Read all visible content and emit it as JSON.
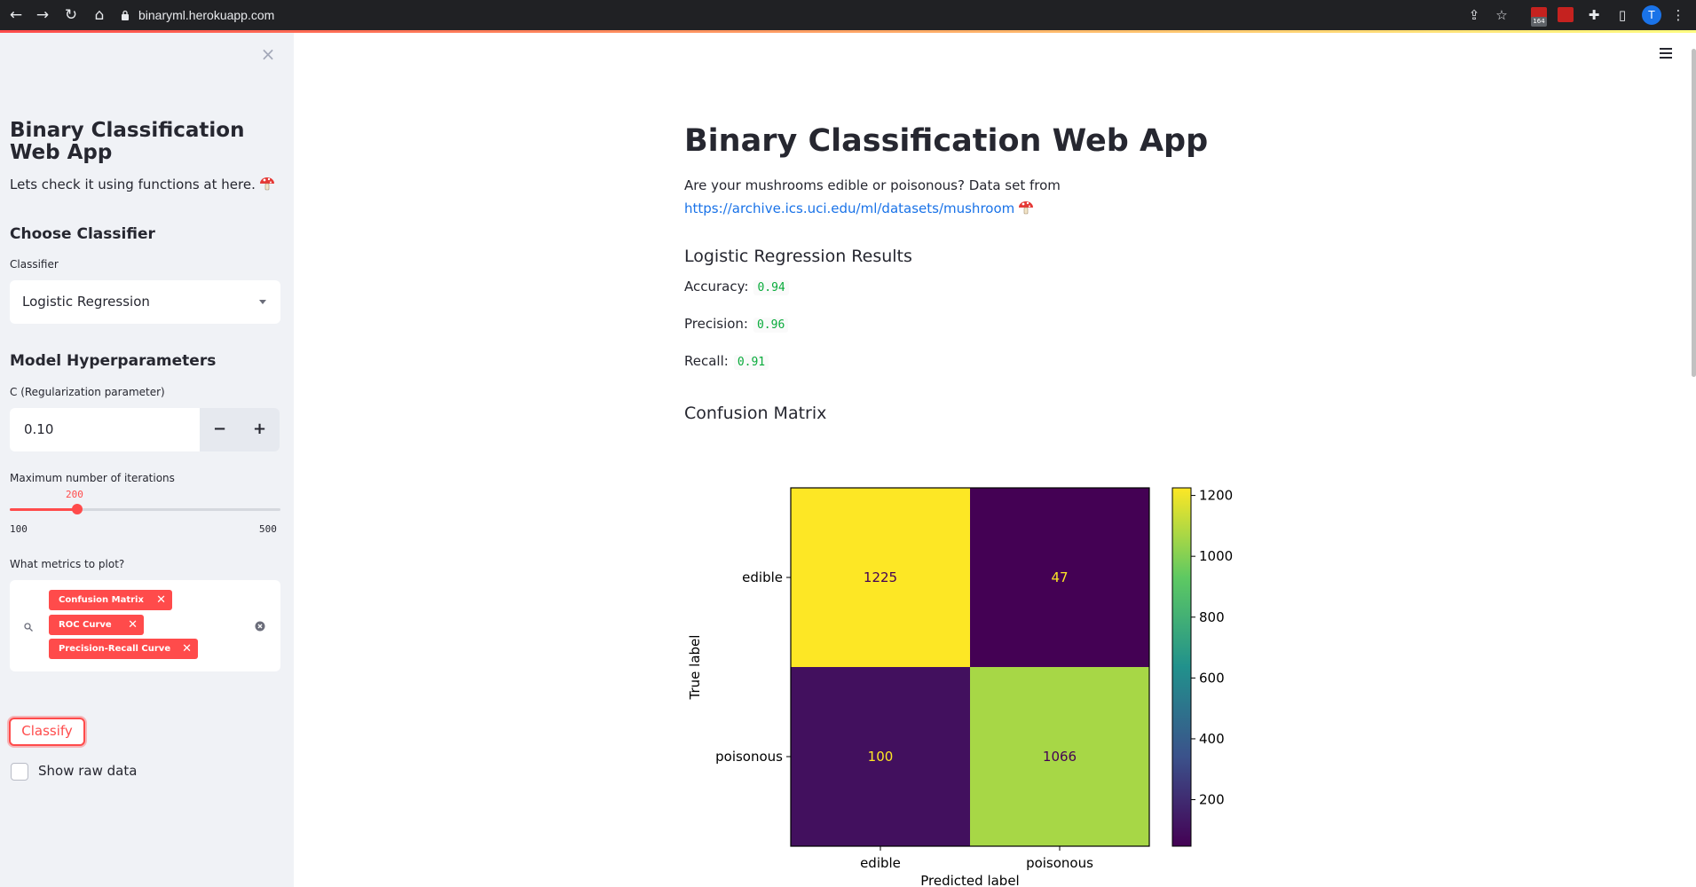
{
  "browser": {
    "url": "binaryml.herokuapp.com",
    "profile_initial": "T",
    "extension_badge": "164"
  },
  "sidebar": {
    "close_label": "×",
    "title": "Binary Classification Web App",
    "subtitle": "Lets check it using functions at here.",
    "choose_heading": "Choose Classifier",
    "classifier_label": "Classifier",
    "classifier_value": "Logistic Regression",
    "hyperparams_heading": "Model Hyperparameters",
    "c_label": "C (Regularization parameter)",
    "c_value": "0.10",
    "minus_label": "−",
    "plus_label": "+",
    "iter_label": "Maximum number of iterations",
    "iter_value": "200",
    "iter_value_num": 200,
    "iter_min": "100",
    "iter_max": "500",
    "metrics_label": "What metrics to plot?",
    "metrics_tags": [
      "Confusion Matrix",
      "ROC Curve",
      "Precision-Recall Curve"
    ],
    "classify_label": "Classify",
    "raw_data_label": "Show raw data"
  },
  "main": {
    "title": "Binary Classification Web App",
    "desc": "Are your mushrooms edible or poisonous? Data set from",
    "dataset_link": "https://archive.ics.uci.edu/ml/datasets/mushroom",
    "results_heading": "Logistic Regression Results",
    "accuracy_label": "Accuracy:",
    "accuracy_value": "0.94",
    "precision_label": "Precision:",
    "precision_value": "0.96",
    "recall_label": "Recall:",
    "recall_value": "0.91",
    "cm_heading": "Confusion Matrix"
  },
  "colors": {
    "accent": "#ff4b4b",
    "sidebar_bg": "#f0f2f6",
    "link": "#1a73e8",
    "code_green": "#09ab3b"
  },
  "chart_data": {
    "type": "heatmap",
    "x_categories": [
      "edible",
      "poisonous"
    ],
    "y_categories": [
      "edible",
      "poisonous"
    ],
    "values": [
      [
        1225,
        47
      ],
      [
        100,
        1066
      ]
    ],
    "xlabel": "Predicted label",
    "ylabel": "True label",
    "colormap": "viridis",
    "colorbar_range": [
      47,
      1225
    ],
    "colorbar_ticks": [
      200,
      400,
      600,
      800,
      1000,
      1200
    ]
  }
}
